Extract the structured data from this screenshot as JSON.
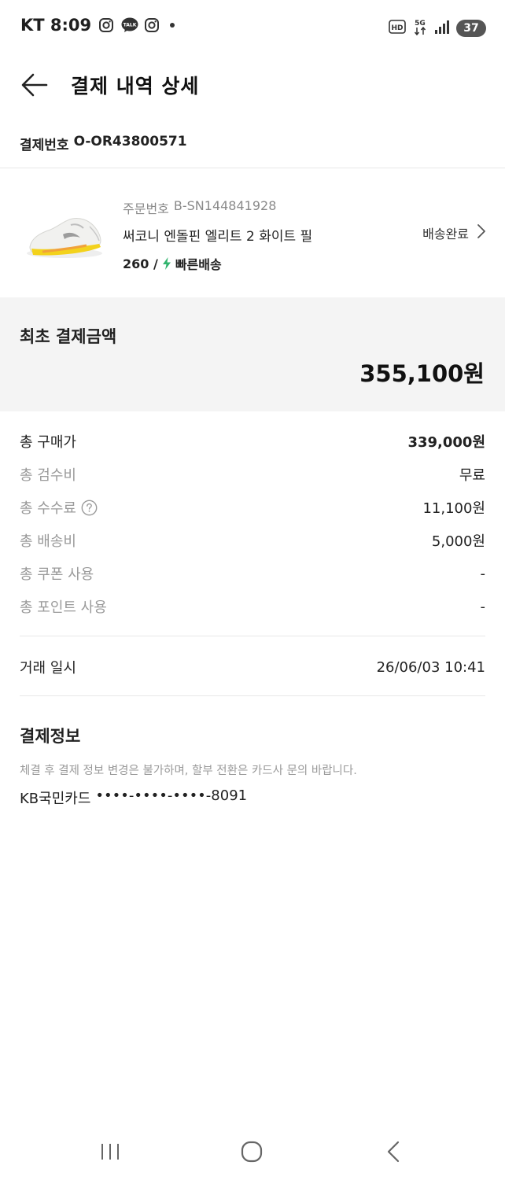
{
  "status_bar": {
    "carrier_time": "KT 8:09",
    "network": "5G",
    "hd_label": "HD",
    "battery": "37",
    "icons": [
      "instagram-icon",
      "kakaotalk-icon",
      "instagram-icon",
      "notification-dot-icon",
      "hd-icon",
      "signal-icon",
      "battery-icon"
    ],
    "kakao_label": "TALK"
  },
  "header": {
    "title": "결제 내역 상세",
    "back_icon": "arrow-left-icon"
  },
  "payment_number": {
    "label": "결제번호",
    "value": "O-OR43800571"
  },
  "product": {
    "order_label": "주문번호",
    "order_number": "B-SN144841928",
    "name": "써코니 엔돌핀 엘리트 2 화이트 필",
    "size": "260 /",
    "shipping_type": "빠른배송",
    "delivery_status": "배송완료",
    "accent_green": "#31b46e"
  },
  "amount": {
    "label": "최초 결제금액",
    "value": "355,100원"
  },
  "breakdown": [
    {
      "label": "총 구매가",
      "value": "339,000원"
    },
    {
      "label": "총 검수비",
      "value": "무료"
    },
    {
      "label": "총 수수료",
      "value": "11,100원"
    },
    {
      "label": "총 배송비",
      "value": "5,000원"
    },
    {
      "label": "총 쿠폰 사용",
      "value": "-"
    },
    {
      "label": "총 포인트 사용",
      "value": "-"
    }
  ],
  "trade": {
    "label": "거래 일시",
    "value": "26/06/03 10:41"
  },
  "payment_info": {
    "title": "결제정보",
    "notice": "체결 후 결제 정보 변경은 불가하며, 할부 전환은 카드사 문의 바랍니다.",
    "card_name": "KB국민카드",
    "card_number": "••••-••••-••••-8091"
  },
  "nav": {
    "icons": [
      "recent-apps-icon",
      "home-icon",
      "back-icon"
    ]
  }
}
